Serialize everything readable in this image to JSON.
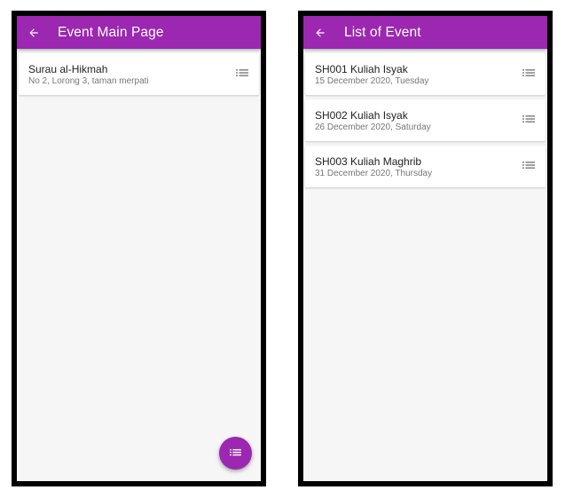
{
  "colors": {
    "accent": "#9c27b0",
    "background": "#f6f6f6",
    "card": "#ffffff"
  },
  "left_screen": {
    "appbar": {
      "back_icon": "arrow-back-icon",
      "title": "Event Main Page"
    },
    "items": [
      {
        "title": "Surau al-Hikmah",
        "subtitle": "No 2, Lorong 3, taman merpati",
        "icon": "list-icon"
      }
    ],
    "fab": {
      "icon": "list-icon"
    }
  },
  "right_screen": {
    "appbar": {
      "back_icon": "arrow-back-icon",
      "title": "List of Event"
    },
    "items": [
      {
        "title": "SH001 Kuliah Isyak",
        "subtitle": "15 December 2020, Tuesday",
        "icon": "list-icon"
      },
      {
        "title": "SH002 Kuliah Isyak",
        "subtitle": "26 December 2020, Saturday",
        "icon": "list-icon"
      },
      {
        "title": "SH003 Kuliah Maghrib",
        "subtitle": "31 December 2020, Thursday",
        "icon": "list-icon"
      }
    ]
  }
}
